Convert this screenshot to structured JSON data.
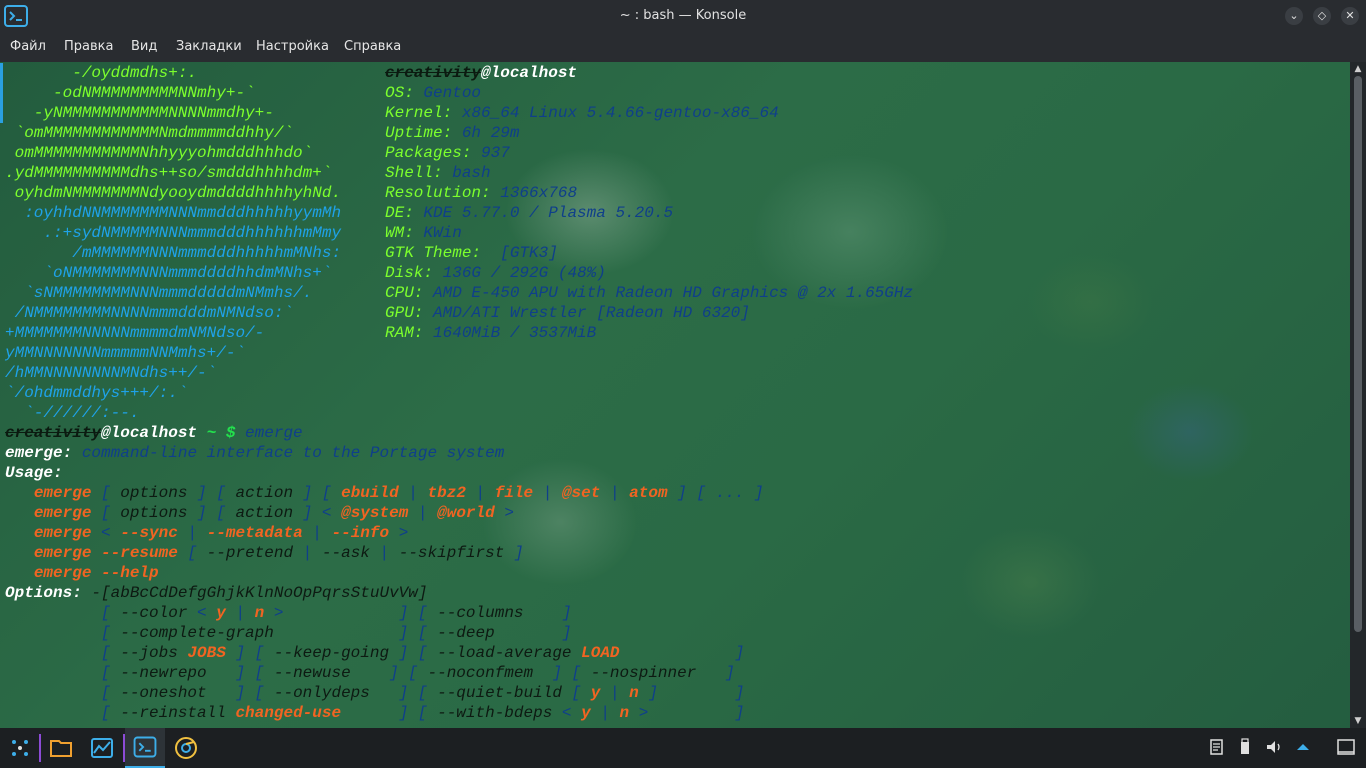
{
  "window": {
    "title": "~ : bash — Konsole",
    "minimize_glyph": "⌄",
    "restore_glyph": "◇",
    "close_glyph": "✕"
  },
  "menu": [
    "Файл",
    "Правка",
    "Вид",
    "Закладки",
    "Настройка",
    "Справка"
  ],
  "logo_lines": [
    "       -/oyddmdhs+:.",
    "     -odNMMMMMMMMMNNmhy+-`",
    "   -yNMMMMMMMMMMMNNNNmmdhy+-",
    " `omMMMMMMMMMMMMNmdmmmmddhhy/`",
    " omMMMMMMMMMMMNhhyyyohmdddhhhdo`",
    ".ydMMMMMMMMMMdhs++so/smdddhhhhdm+`",
    " oyhdmNMMMMMMMNdyooydmddddhhhhyhNd.",
    "  :oyhhdNNMMMMMMMNNNmmdddhhhhhyymMh",
    "    .:+sydNMMMMMNNNmmmdddhhhhhhmMmy",
    "       /mMMMMMMNNNmmmdddhhhhhmMNhs:",
    "    `oNMMMMMMMNNNmmmddddhhdmMNhs+`",
    "  `sNMMMMMMMMNNNmmmdddddmNMmhs/.",
    " /NMMMMMMMMNNNNmmmdddmNMNdso:`",
    "+MMMMMMMNNNNNmmmmdmNMNdso/-",
    "yMMNNNNNNNmmmmmNNMmhs+/-`",
    "/hMMNNNNNNNNMNdhs++/-`",
    "`/ohdmmddhys+++/:.`",
    "  `-//////:--."
  ],
  "sysinfo": {
    "user": "creativity",
    "host": "@localhost",
    "rows": [
      {
        "label": "OS:",
        "value": " Gentoo"
      },
      {
        "label": "Kernel:",
        "value": " x86_64 Linux 5.4.66-gentoo-x86_64"
      },
      {
        "label": "Uptime:",
        "value": " 6h 29m"
      },
      {
        "label": "Packages:",
        "value": " 937"
      },
      {
        "label": "Shell:",
        "value": " bash"
      },
      {
        "label": "Resolution:",
        "value": " 1366x768"
      },
      {
        "label": "DE:",
        "value": " KDE 5.77.0 / Plasma 5.20.5"
      },
      {
        "label": "WM:",
        "value": " KWin"
      },
      {
        "label": "GTK Theme:",
        "value": "  [GTK3]"
      },
      {
        "label": "Disk:",
        "value": " 136G / 292G (48%)"
      },
      {
        "label": "CPU:",
        "value": " AMD E-450 APU with Radeon HD Graphics @ 2x 1.65GHz"
      },
      {
        "label": "GPU:",
        "value": " AMD/ATI Wrestler [Radeon HD 6320]"
      },
      {
        "label": "RAM:",
        "value": " 1640MiB / 3537MiB"
      }
    ]
  },
  "prompt": {
    "user": "creativity",
    "host": "@localhost",
    "path": " ~ $",
    "command": " emerge"
  },
  "emerge_desc": {
    "name": "emerge:",
    "text": " command-line interface to the Portage system"
  },
  "usage_label": "Usage:",
  "usage1": [
    "   ",
    "emerge",
    " [ ",
    "options",
    " ] [ ",
    "action",
    " ] [ ",
    "ebuild",
    " | ",
    "tbz2",
    " | ",
    "file",
    " | ",
    "@set",
    " | ",
    "atom",
    " ] [ ... ]"
  ],
  "usage2": [
    "   ",
    "emerge",
    " [ ",
    "options",
    " ] [ ",
    "action",
    " ] < ",
    "@system",
    " | ",
    "@world",
    " >"
  ],
  "usage3": [
    "   ",
    "emerge",
    " < ",
    "--sync",
    " | ",
    "--metadata",
    " | ",
    "--info",
    " >"
  ],
  "usage4": [
    "   ",
    "emerge --resume",
    " [ ",
    "--pretend",
    " | ",
    "--ask",
    " | ",
    "--skipfirst",
    " ]"
  ],
  "usage5": [
    "   ",
    "emerge --help"
  ],
  "options_label": "Options:",
  "options_flags": " -[abBcCdDefgGhjkKlnNoOpPqrsStuUvVw]",
  "opt1": [
    "          [ ",
    "--color",
    " < ",
    "y",
    " | ",
    "n",
    " >            ] [ ",
    "--columns",
    "    ]"
  ],
  "opt2": [
    "          [ ",
    "--complete-graph",
    "             ] [ ",
    "--deep",
    "       ]"
  ],
  "opt3": [
    "          [ ",
    "--jobs",
    " ",
    "JOBS",
    " ] [ ",
    "--keep-going",
    " ] [ ",
    "--load-average",
    " ",
    "LOAD",
    "            ]"
  ],
  "opt4": [
    "          [ ",
    "--newrepo",
    "   ] [ ",
    "--newuse",
    "    ] [ ",
    "--noconfmem",
    "  ] [ ",
    "--nospinner",
    "   ]"
  ],
  "opt5": [
    "          [ ",
    "--oneshot",
    "   ] [ ",
    "--onlydeps",
    "   ] [ ",
    "--quiet-build",
    " [ ",
    "y",
    " | ",
    "n",
    " ]        ]"
  ],
  "opt6": [
    "          [ ",
    "--reinstall",
    " ",
    "changed-use",
    "      ] [ ",
    "--with-bdeps",
    " < ",
    "y",
    " | ",
    "n",
    " >         ]"
  ]
}
